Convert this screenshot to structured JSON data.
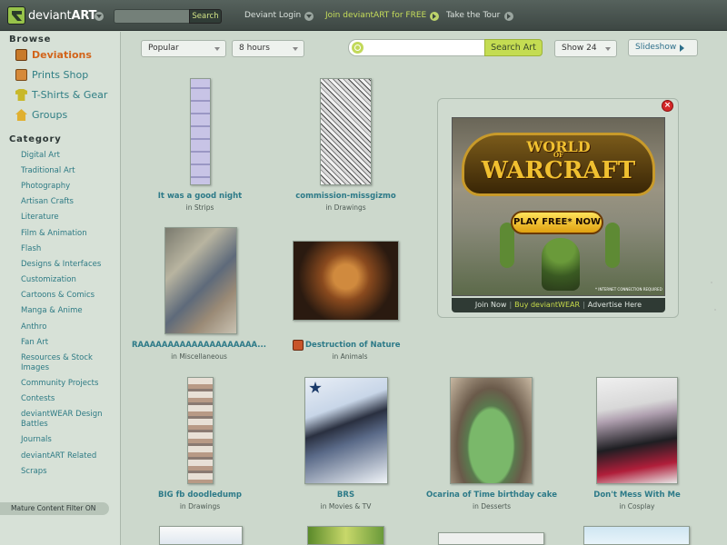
{
  "topbar": {
    "logo_text": "deviant",
    "logo_bold": "ART",
    "search_button": "Search",
    "login": "Deviant Login",
    "join": "Join deviantART for FREE",
    "tour": "Take the Tour"
  },
  "sidebar": {
    "browse_heading": "Browse",
    "browse": [
      {
        "label": "Deviations",
        "icon": "deviations-icon",
        "active": true
      },
      {
        "label": "Prints Shop",
        "icon": "prints-icon"
      },
      {
        "label": "T-Shirts & Gear",
        "icon": "tshirt-icon"
      },
      {
        "label": "Groups",
        "icon": "groups-icon"
      }
    ],
    "category_heading": "Category",
    "categories": [
      "Digital Art",
      "Traditional Art",
      "Photography",
      "Artisan Crafts",
      "Literature",
      "Film & Animation",
      "Flash",
      "Designs & Interfaces",
      "Customization",
      "Cartoons & Comics",
      "Manga & Anime",
      "Anthro",
      "Fan Art",
      "Resources & Stock Images",
      "Community Projects",
      "Contests",
      "deviantWEAR Design Battles",
      "Journals",
      "deviantART Related",
      "Scraps"
    ],
    "mature_filter": "Mature Content Filter ON"
  },
  "toolbar": {
    "sort": "Popular",
    "timeframe": "8 hours",
    "search_value": "",
    "search_button": "Search Art",
    "show": "Show 24",
    "slideshow": "Slideshow"
  },
  "thumbnails": [
    {
      "title": "It was a good night",
      "category": "Strips"
    },
    {
      "title": "commission-missgizmo",
      "category": "Drawings"
    },
    {
      "title": "RAAAAAAAAAAAAAAAAAAAA...",
      "category": "Miscellaneous"
    },
    {
      "title": "Destruction of Nature",
      "category": "Animals"
    },
    {
      "title": "BIG fb doodledump",
      "category": "Drawings"
    },
    {
      "title": "BRS",
      "category": "Movies & TV"
    },
    {
      "title": "Ocarina of Time birthday cake",
      "category": "Desserts"
    },
    {
      "title": "Don't Mess With Me",
      "category": "Cosplay"
    }
  ],
  "in_label": "in",
  "ad": {
    "emblem_top": "WORLD",
    "emblem_of": "OF",
    "emblem_main": "WARCRAFT",
    "play": "PLAY FREE* NOW",
    "fine_print": "* INTERNET CONNECTION REQUIRED",
    "links": [
      "Join Now",
      "Buy deviantWEAR",
      "Advertise Here"
    ]
  }
}
